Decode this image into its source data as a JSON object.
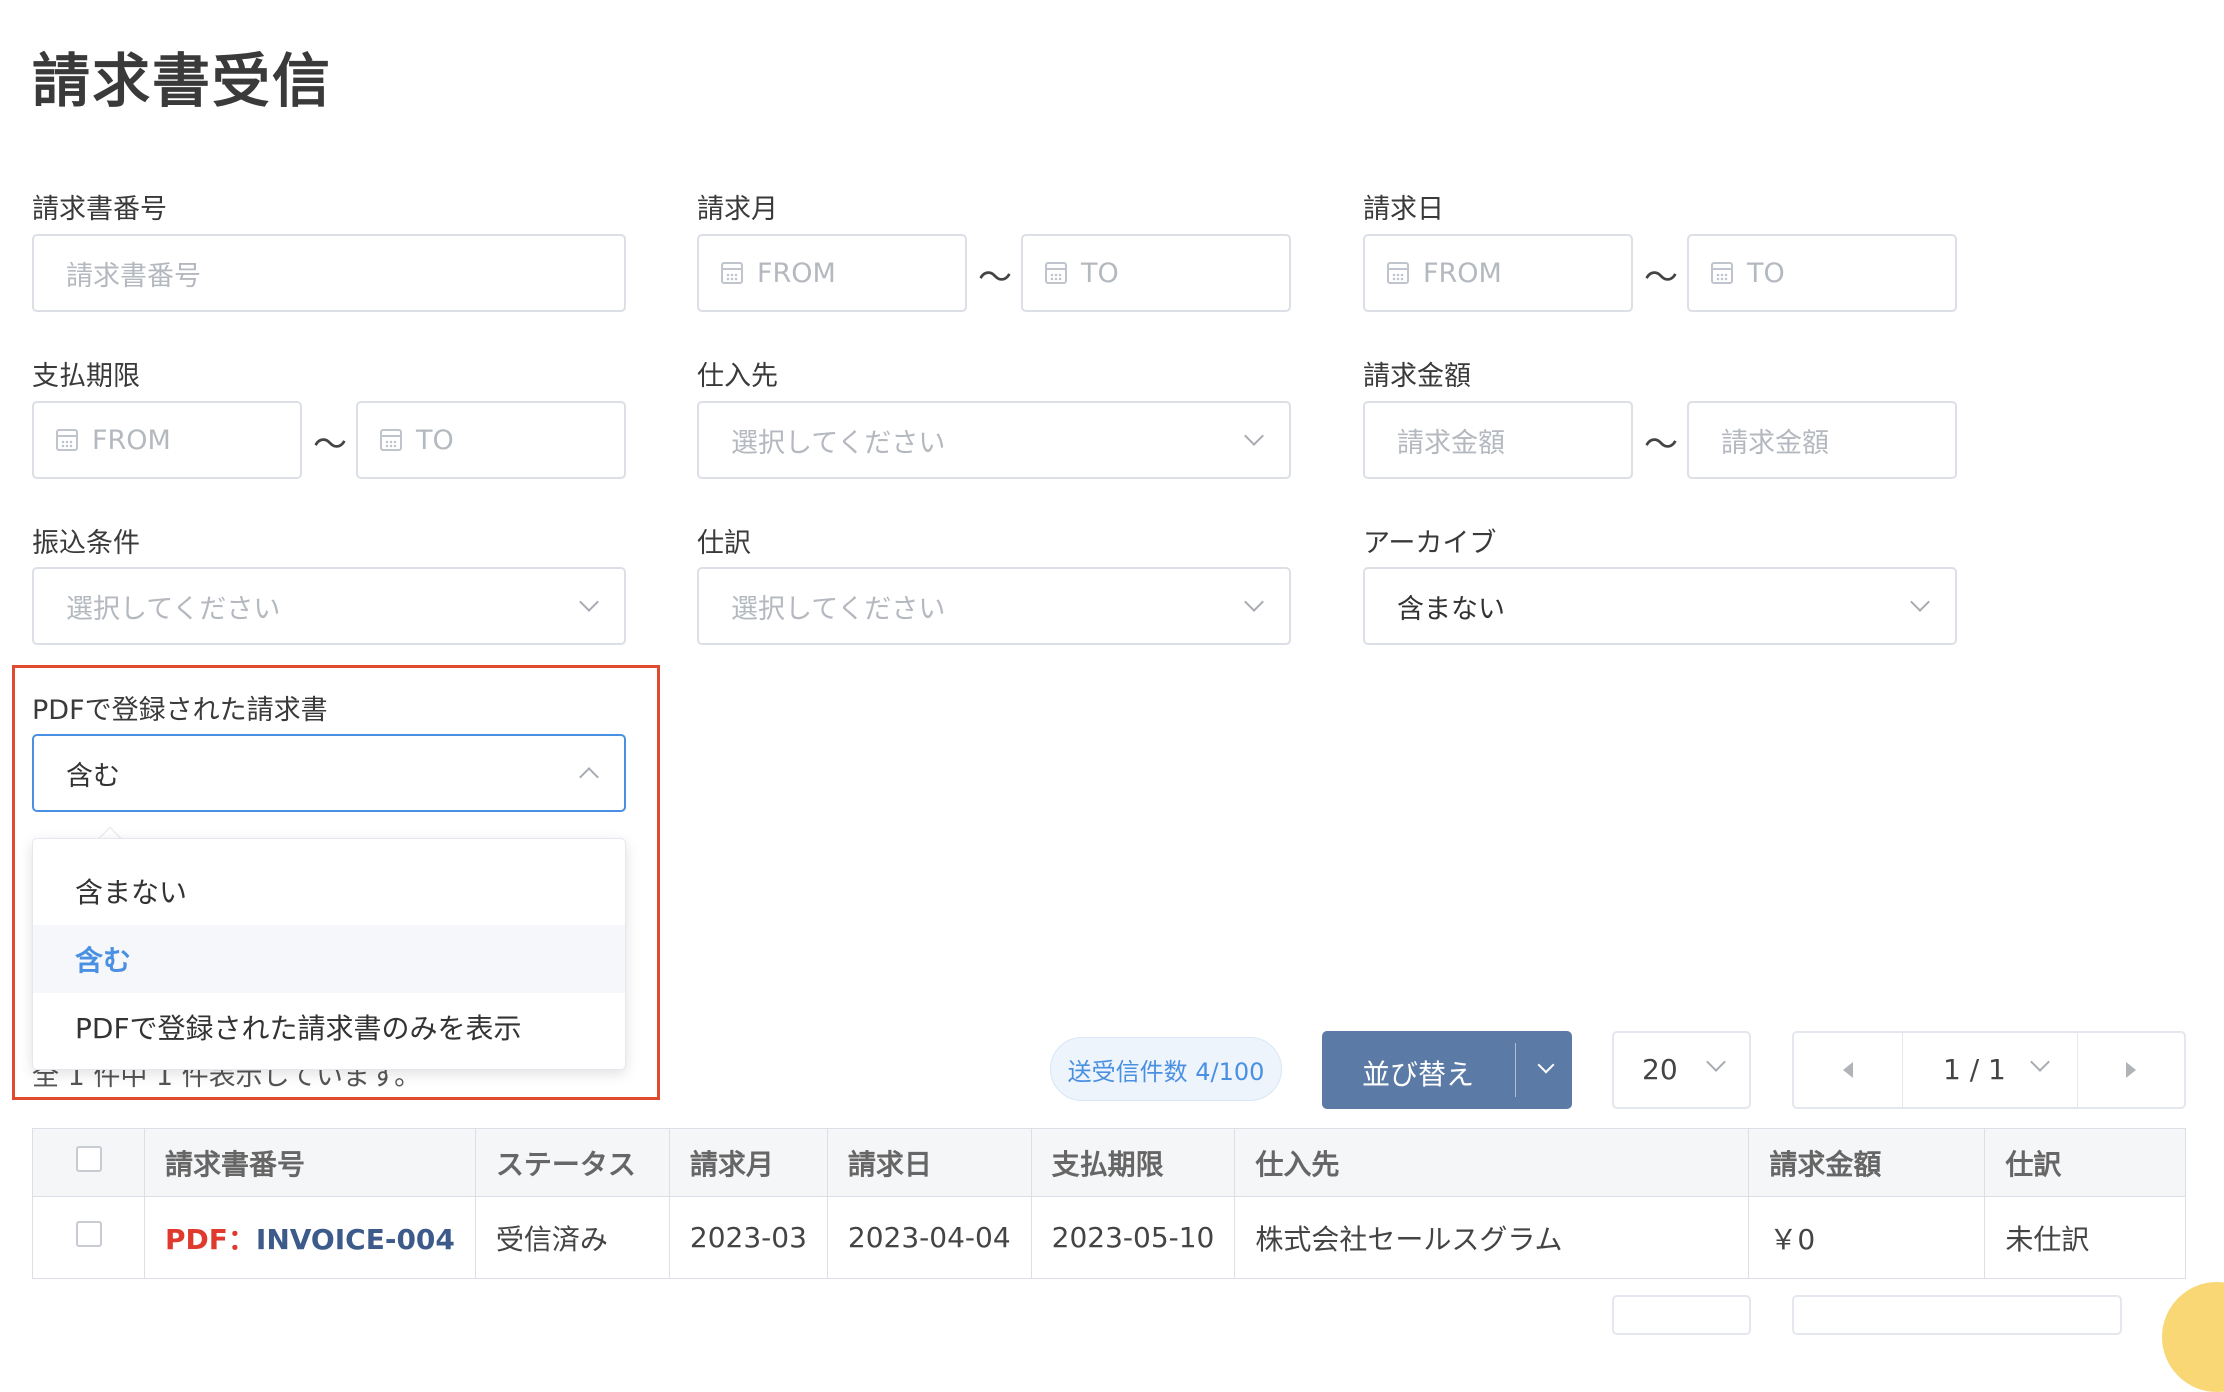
{
  "page": {
    "title": "請求書受信"
  },
  "filters": {
    "invoice_number": {
      "label": "請求書番号",
      "placeholder": "請求書番号"
    },
    "billing_month": {
      "label": "請求月",
      "from": "FROM",
      "to": "TO"
    },
    "billing_date": {
      "label": "請求日",
      "from": "FROM",
      "to": "TO"
    },
    "due_date": {
      "label": "支払期限",
      "from": "FROM",
      "to": "TO"
    },
    "supplier": {
      "label": "仕入先",
      "placeholder": "選択してください"
    },
    "amount": {
      "label": "請求金額",
      "from_placeholder": "請求金額",
      "to_placeholder": "請求金額"
    },
    "transfer_terms": {
      "label": "振込条件",
      "placeholder": "選択してください"
    },
    "journal": {
      "label": "仕訳",
      "placeholder": "選択してください"
    },
    "archive": {
      "label": "アーカイブ",
      "value": "含まない"
    },
    "pdf_registered": {
      "label": "PDFで登録された請求書",
      "value": "含む",
      "options": [
        "含まない",
        "含む",
        "PDFで登録された請求書のみを表示"
      ],
      "selected_index": 1
    },
    "range_separator": "〜"
  },
  "toolbar": {
    "count_text": "全 1 件中 1 件表示しています。",
    "send_receive_badge": "送受信件数 4/100",
    "sort_label": "並び替え",
    "page_size": "20",
    "page_indicator": "1 / 1"
  },
  "table": {
    "columns": [
      "請求書番号",
      "ステータス",
      "請求月",
      "請求日",
      "支払期限",
      "仕入先",
      "請求金額",
      "仕訳"
    ],
    "rows": [
      {
        "pdf_prefix": "PDF：",
        "invoice_number": "INVOICE-004",
        "status": "受信済み",
        "billing_month": "2023-03",
        "billing_date": "2023-04-04",
        "due_date": "2023-05-10",
        "supplier": "株式会社セールスグラム",
        "amount": "￥0",
        "journal": "未仕訳"
      }
    ]
  },
  "colors": {
    "highlight_border": "#e04a2f",
    "sort_button": "#5b7ba6",
    "selected_option": "#4a90e2",
    "pdf_prefix": "#e03a2e",
    "invoice_link": "#3c5a8a"
  },
  "icons": [
    "calendar-icon",
    "chevron-down-icon",
    "chevron-up-icon",
    "caret-left-icon",
    "caret-right-icon"
  ]
}
